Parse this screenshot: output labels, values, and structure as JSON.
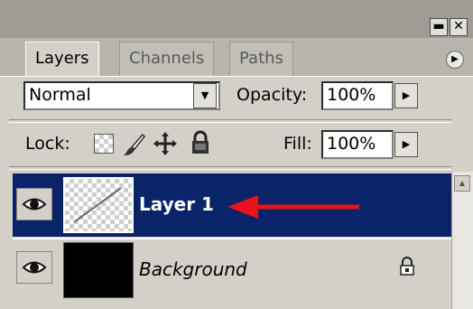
{
  "panel": {
    "window_controls": {
      "minimize": "▬",
      "close": "✕"
    },
    "tabs": [
      {
        "label": "Layers",
        "active": true
      },
      {
        "label": "Channels",
        "active": false
      },
      {
        "label": "Paths",
        "active": false
      }
    ],
    "menu_icon": "▶"
  },
  "blend": {
    "mode": "Normal",
    "dropdown_icon": "▼"
  },
  "opacity": {
    "label": "Opacity:",
    "value": "100%",
    "arrow": "▶"
  },
  "lock": {
    "label": "Lock:",
    "icons": [
      "lock-transparent-icon",
      "lock-brush-icon",
      "lock-move-icon",
      "lock-all-icon"
    ]
  },
  "fill": {
    "label": "Fill:",
    "value": "100%",
    "arrow": "▶"
  },
  "layers": [
    {
      "name": "Layer 1",
      "selected": true,
      "visible": true
    },
    {
      "name": "Background",
      "selected": false,
      "visible": true,
      "locked": true
    }
  ],
  "colors": {
    "selection": "#0a246a",
    "annotation_arrow": "#e8141c"
  }
}
